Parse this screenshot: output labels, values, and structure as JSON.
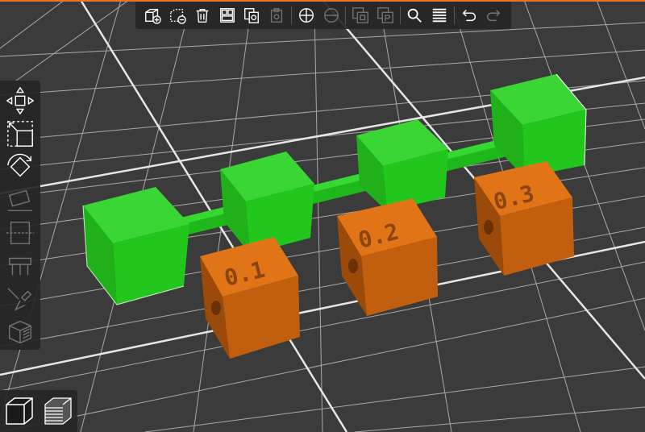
{
  "app": {
    "accent_color": "#e8732a",
    "bed_color": "#3b3b3b",
    "grid_color": "#c8c8c8"
  },
  "top_toolbar": {
    "buttons": [
      {
        "name": "add-part-icon",
        "state": "enabled"
      },
      {
        "name": "delete-part-icon",
        "state": "enabled"
      },
      {
        "name": "delete-all-icon",
        "state": "enabled"
      },
      {
        "name": "arrange-icon",
        "state": "enabled"
      },
      {
        "name": "copy-icon",
        "state": "enabled"
      },
      {
        "name": "paste-icon",
        "state": "disabled"
      },
      {
        "name": "add-instance-icon",
        "state": "enabled"
      },
      {
        "name": "remove-instance-icon",
        "state": "disabled"
      },
      {
        "name": "split-objects-icon",
        "state": "disabled"
      },
      {
        "name": "split-parts-icon",
        "state": "disabled"
      },
      {
        "name": "search-icon",
        "state": "enabled"
      },
      {
        "name": "variable-layer-height-icon",
        "state": "enabled"
      },
      {
        "name": "undo-icon",
        "state": "enabled"
      },
      {
        "name": "redo-icon",
        "state": "disabled"
      }
    ]
  },
  "left_toolbar": {
    "tools": [
      {
        "name": "move-tool-icon",
        "state": "enabled"
      },
      {
        "name": "scale-tool-icon",
        "state": "enabled"
      },
      {
        "name": "rotate-tool-icon",
        "state": "enabled"
      },
      {
        "name": "place-on-face-icon",
        "state": "disabled"
      },
      {
        "name": "cut-tool-icon",
        "state": "disabled"
      },
      {
        "name": "support-paint-icon",
        "state": "disabled"
      },
      {
        "name": "seam-paint-icon",
        "state": "disabled"
      },
      {
        "name": "variable-layer-tool-icon",
        "state": "disabled"
      }
    ]
  },
  "view_toggle": {
    "items": [
      {
        "name": "3d-view-icon",
        "active": true
      },
      {
        "name": "preview-layers-icon",
        "active": false
      }
    ]
  },
  "scene": {
    "green_color": "#22c71c",
    "orange_color": "#d86a10",
    "labels": [
      "0.1",
      "0.2",
      "0.3"
    ]
  }
}
